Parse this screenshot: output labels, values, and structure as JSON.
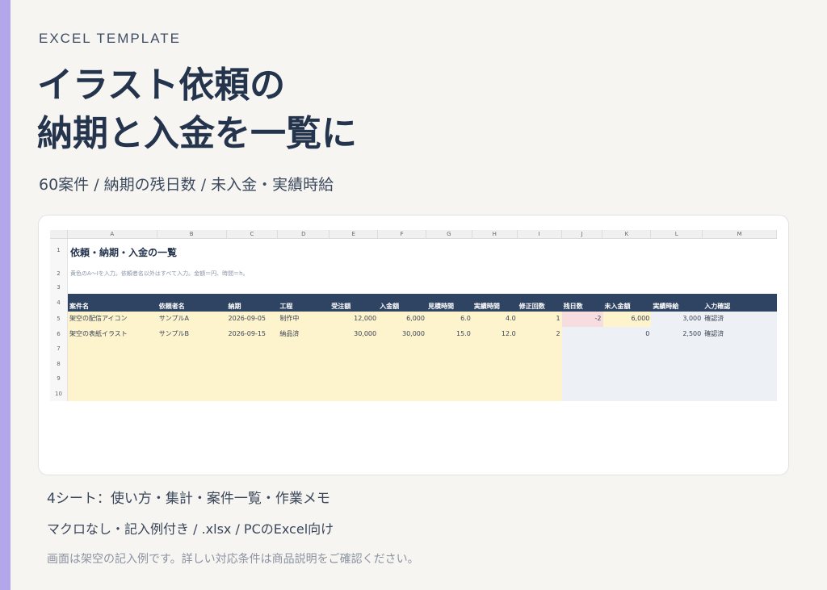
{
  "eyebrow": "EXCEL TEMPLATE",
  "headline": {
    "line1": "イラスト依頼の",
    "line2": "納期と入金を一覧に"
  },
  "subhead": "60案件 / 納期の残日数 / 未入金・実績時給",
  "sheet": {
    "columns": [
      "A",
      "B",
      "C",
      "D",
      "E",
      "F",
      "G",
      "H",
      "I",
      "J",
      "K",
      "L",
      "M"
    ],
    "row_numbers": [
      "1",
      "2",
      "3",
      "4",
      "5",
      "6",
      "7",
      "8",
      "9",
      "10"
    ],
    "title": "依頼・納期・入金の一覧",
    "note": "黄色のA〜Iを入力。依頼者名以外はすべて入力。金額＝円、時間＝h。",
    "headers": [
      "案件名",
      "依頼者名",
      "納期",
      "工程",
      "受注額",
      "入金額",
      "見積時間",
      "実績時間",
      "修正回数",
      "残日数",
      "未入金額",
      "実績時給",
      "入力確認"
    ],
    "dropdown_glyph": "▾",
    "rows": [
      {
        "name": "架空の配信アイコン",
        "client": "サンプルA",
        "due": "2026-09-05",
        "stage": "制作中",
        "order": "12,000",
        "paid": "6,000",
        "est": "6.0",
        "actual": "4.0",
        "revisions": "1",
        "days_left": "-2",
        "unpaid": "6,000",
        "rate": "3,000",
        "check": "確認済"
      },
      {
        "name": "架空の表紙イラスト",
        "client": "サンプルB",
        "due": "2026-09-15",
        "stage": "納品済",
        "order": "30,000",
        "paid": "30,000",
        "est": "15.0",
        "actual": "12.0",
        "revisions": "2",
        "days_left": "",
        "unpaid": "0",
        "rate": "2,500",
        "check": "確認済"
      }
    ]
  },
  "footer": {
    "line1": "4シート：使い方・集計・案件一覧・作業メモ",
    "line2": "マクロなし・記入例付き / .xlsx / PCのExcel向け",
    "line3": "画面は架空の記入例です。詳しい対応条件は商品説明をご確認ください。"
  },
  "colors": {
    "accent_bar": "#b3a6ea",
    "header_fill": "#2f4463",
    "input_fill": "#fdf3cc",
    "calc_fill": "#edf0f5",
    "alert_fill": "#f8dde0"
  }
}
